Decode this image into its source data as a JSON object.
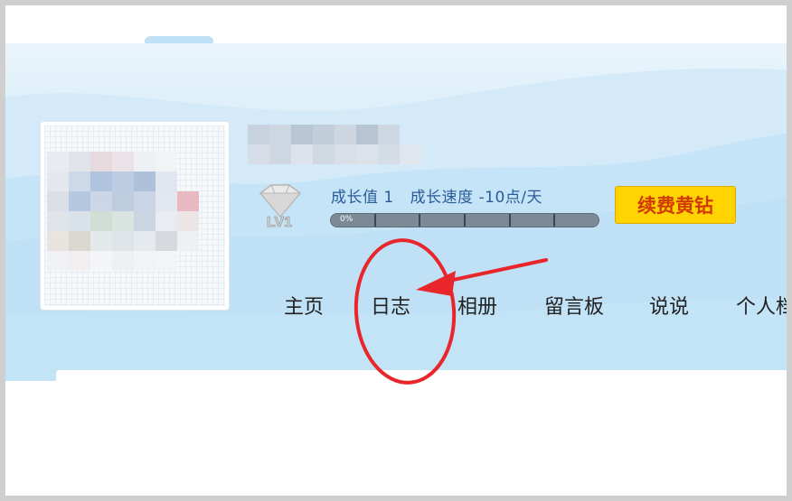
{
  "profile": {
    "growth_label": "成长值 1",
    "growth_speed": "成长速度 -10点/天",
    "level": "LV1",
    "progress_percent_label": "0%",
    "progress_value": 0
  },
  "renew_button": {
    "label": "续费黄钻",
    "color": "#ffd400",
    "text_color": "#d23a00"
  },
  "nav": {
    "items": [
      {
        "label": "主页"
      },
      {
        "label": "日志"
      },
      {
        "label": "相册"
      },
      {
        "label": "留言板"
      },
      {
        "label": "说说"
      },
      {
        "label": "个人档"
      }
    ]
  },
  "annotation": {
    "color": "#e8262b",
    "target": "日志"
  },
  "icons": {
    "level_badge": "diamond-level-icon"
  }
}
